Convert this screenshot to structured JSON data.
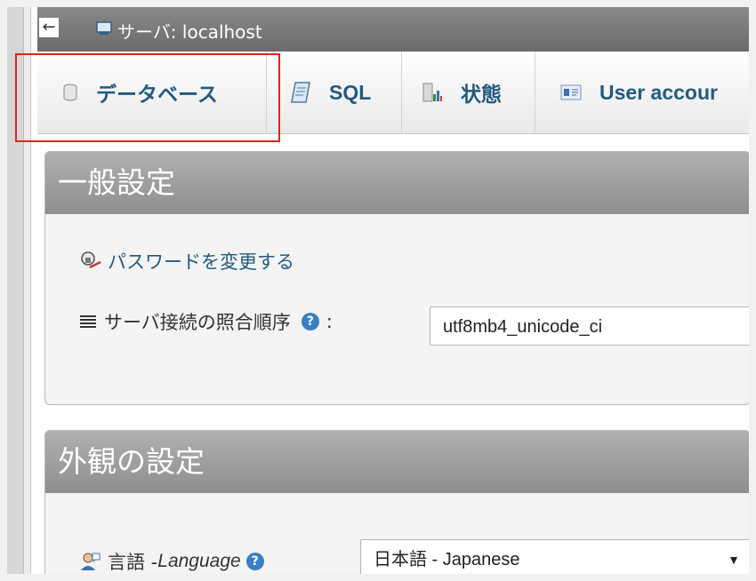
{
  "serverbar": {
    "collapse_icon": "left-arrow-icon",
    "server_icon": "server-icon",
    "label": "サーバ: localhost"
  },
  "tabs": [
    {
      "icon": "database-icon",
      "label": "データベース"
    },
    {
      "icon": "sql-icon",
      "label": "SQL"
    },
    {
      "icon": "status-chart-icon",
      "label": "状態"
    },
    {
      "icon": "user-accounts-icon",
      "label": "User accour"
    }
  ],
  "general": {
    "title": "一般設定",
    "change_password": "パスワードを変更する",
    "collation_label": "サーバ接続の照合順序",
    "collation_suffix": ":",
    "collation_value": "utf8mb4_unicode_ci"
  },
  "appearance": {
    "title": "外観の設定",
    "language_label": "言語 - ",
    "language_label_en": "Language",
    "language_value": "日本語 - Japanese"
  },
  "colors": {
    "link": "#235a81",
    "highlight": "#e1231f",
    "header": "#999999"
  }
}
